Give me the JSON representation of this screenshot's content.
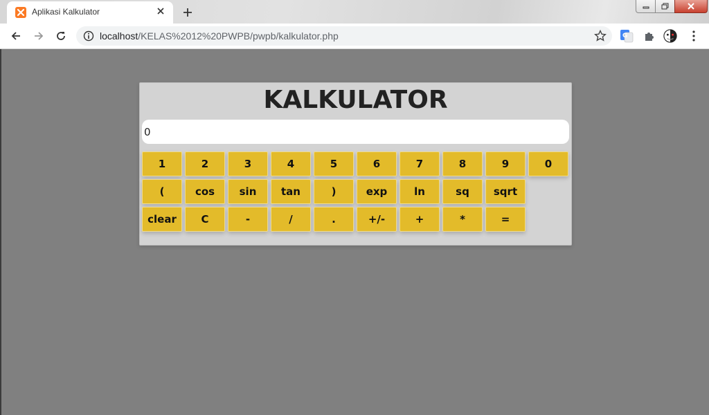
{
  "browser": {
    "tab_title": "Aplikasi Kalkulator",
    "url_host": "localhost",
    "url_path": "/KELAS%2012%20PWPB/pwpb/kalkulator.php",
    "favicon_color": "#fb7a24"
  },
  "calculator": {
    "title": "KALKULATOR",
    "display_value": "0",
    "button_color": "#e3bb2a",
    "panel_color": "#d3d3d3",
    "rows": [
      [
        "1",
        "2",
        "3",
        "4",
        "5",
        "6",
        "7",
        "8",
        "9",
        "0"
      ],
      [
        "(",
        "cos",
        "sin",
        "tan",
        ")",
        "exp",
        "ln",
        "sq",
        "sqrt"
      ],
      [
        "clear",
        "C",
        "-",
        "/",
        ".",
        "+/-",
        "+",
        "*",
        "="
      ]
    ]
  }
}
